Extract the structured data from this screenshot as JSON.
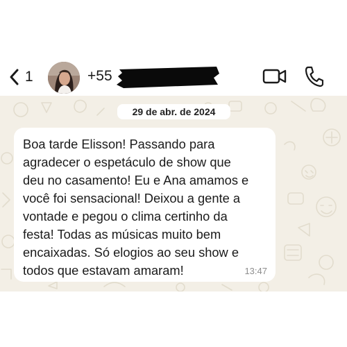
{
  "header": {
    "back_count": "1",
    "contact_name": "+55"
  },
  "chat": {
    "date_badge": "29 de abr. de 2024",
    "message": {
      "text": "Boa tarde Elisson! Passando para\nagradecer o espetáculo de show que\ndeu no casamento! Eu e Ana amamos e\nvocê foi sensacional! Deixou a gente a\nvontade e pegou o clima certinho da\nfesta! Todas as músicas muito bem\nencaixadas. Só elogios ao seu show e\ntodos que estavam amaram!",
      "time": "13:47"
    }
  },
  "colors": {
    "chat_background": "#f3efe6",
    "bubble": "#ffffff",
    "icons": "#1a1a1a",
    "timestamp": "#8d8d8d"
  },
  "icons": [
    "chevron-left-icon",
    "video-camera-icon",
    "phone-icon"
  ]
}
